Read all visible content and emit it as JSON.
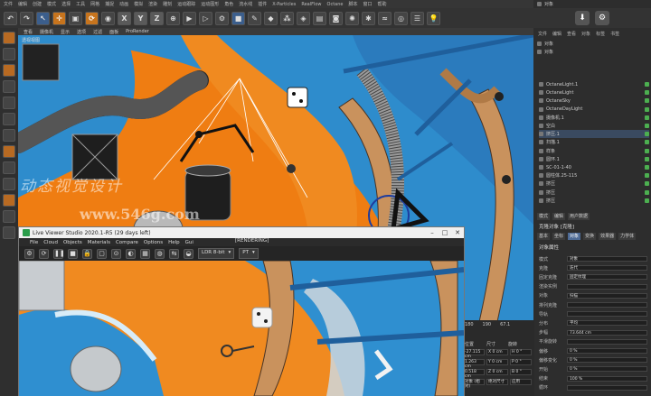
{
  "menubar": [
    "文件",
    "编辑",
    "创建",
    "模式",
    "选择",
    "工具",
    "网格",
    "捕捉",
    "动画",
    "模拟",
    "渲染",
    "雕刻",
    "运动跟踪",
    "运动图形",
    "角色",
    "流水线",
    "插件",
    "X-Particles",
    "RealFlow",
    "Octane",
    "脚本",
    "窗口",
    "帮助"
  ],
  "toolbar": {
    "axis_labels": [
      "X",
      "Y",
      "Z"
    ]
  },
  "viewport": {
    "menu": [
      "查看",
      "摄像机",
      "显示",
      "选项",
      "过滤",
      "面板",
      "ProRender"
    ],
    "label": "透视视图"
  },
  "watermark": {
    "line1": "动态视觉设计",
    "line2": "www.546g.com"
  },
  "object_manager": {
    "menu": [
      "文件",
      "编辑",
      "查看",
      "对象",
      "标签",
      "书签"
    ],
    "top_rows": [
      "对象",
      "对象",
      "对象"
    ],
    "rows": [
      {
        "label": "OctaneLight.1",
        "selected": false
      },
      {
        "label": "OctaneLight",
        "selected": false
      },
      {
        "label": "OctaneSky",
        "selected": false
      },
      {
        "label": "OctaneDayLight",
        "selected": false
      },
      {
        "label": "摄像机.1",
        "selected": false
      },
      {
        "label": "空白",
        "selected": false
      },
      {
        "label": "挤压.1",
        "selected": true
      },
      {
        "label": "扫描.1",
        "selected": false
      },
      {
        "label": "样条",
        "selected": false
      },
      {
        "label": "圆环.1",
        "selected": false
      },
      {
        "label": "SC-01-1-40",
        "selected": false
      },
      {
        "label": "圆柱体.25-115",
        "selected": false
      },
      {
        "label": "挤压",
        "selected": false
      },
      {
        "label": "挤压",
        "selected": false
      },
      {
        "label": "挤压",
        "selected": false
      }
    ]
  },
  "attributes": {
    "tabs_row1": [
      "模式",
      "编辑",
      "用户数据"
    ],
    "header": "克隆对象 [克隆]",
    "tabs_row2": [
      "基本",
      "坐标",
      "对象",
      "变换",
      "效果器",
      "力学体"
    ],
    "section": "对象属性",
    "rows": [
      {
        "label": "模式",
        "value": "对象"
      },
      {
        "label": "克隆",
        "value": "迭代"
      },
      {
        "label": "固定克隆",
        "value": "固定纹理"
      },
      {
        "label": "渲染实例",
        "value": ""
      },
      {
        "label": "对象",
        "value": "扫描"
      },
      {
        "label": "排列克隆",
        "value": ""
      },
      {
        "label": "导轨",
        "value": ""
      },
      {
        "label": "分布",
        "value": "平均"
      },
      {
        "label": "步幅",
        "value": "73.644 cm"
      },
      {
        "label": "平滑旋转",
        "value": ""
      },
      {
        "label": "偏移",
        "value": "0 %"
      },
      {
        "label": "偏移变化",
        "value": "0 %"
      },
      {
        "label": "开始",
        "value": "0 %"
      },
      {
        "label": "结束",
        "value": "100 %"
      },
      {
        "label": "循环",
        "value": ""
      }
    ]
  },
  "coords": {
    "values": [
      "180",
      "190",
      "67.1"
    ],
    "labels": [
      "位置",
      "尺寸",
      "旋转"
    ],
    "rows": [
      [
        "-27.115 cm",
        "X 0 cm",
        "H 0 °"
      ],
      [
        "1.263 cm",
        "Y 0 cm",
        "P 0 °"
      ],
      [
        "0.518 cm",
        "Z 0 cm",
        "B 0 °"
      ],
      [
        "对象 (相对)",
        "绝对尺寸",
        "应用"
      ]
    ]
  },
  "live_viewer": {
    "title": "Live Viewer Studio 2020.1-R5 (29 days left)",
    "status": "[RENDERING]",
    "menu": [
      "File",
      "Cloud",
      "Objects",
      "Materials",
      "Compare",
      "Options",
      "Help",
      "Gui"
    ],
    "buttons": [
      "❚❚",
      "⟳",
      "∥",
      "■",
      "⚙"
    ],
    "ldr": "LDR 8-bit",
    "pt": "PT",
    "win_min": "–",
    "win_max": "□",
    "win_close": "✕"
  }
}
